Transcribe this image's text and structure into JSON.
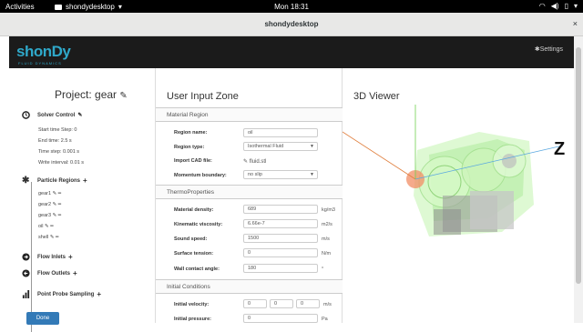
{
  "topbar": {
    "activities": "Activities",
    "app_name": "shondydesktop",
    "clock": "Mon 18:31"
  },
  "window": {
    "title": "shondydesktop",
    "close": "×"
  },
  "header": {
    "logo": "shonDy",
    "logo_sub": "FLUID DYNAMICS",
    "settings": "Settings"
  },
  "project": {
    "title": "Project: gear"
  },
  "solver": {
    "label": "Solver Control",
    "items": [
      "Start time Step: 0",
      "End time: 2.5 s",
      "Time step: 0.001 s",
      "Write interval: 0.01 s"
    ]
  },
  "particles": {
    "label": "Particle Regions",
    "items": [
      "gear1",
      "gear2",
      "gear3",
      "oil",
      "shell"
    ]
  },
  "flow_inlets": "Flow Inlets",
  "flow_outlets": "Flow Outlets",
  "probe": "Point Probe Sampling",
  "done": "Done",
  "input": {
    "title": "User Input Zone",
    "material_section": "Material Region",
    "region_name_label": "Region name:",
    "region_name": "oil",
    "region_type_label": "Region type:",
    "region_type": "Isothermal Fluid",
    "import_cad_label": "Import CAD file:",
    "cad_file": "fluid.stl",
    "momentum_label": "Momentum boundary:",
    "momentum": "no slip",
    "thermo_section": "ThermoProperties",
    "density_label": "Material density:",
    "density": "689",
    "density_unit": "kg/m3",
    "viscosity_label": "Kinematic viscosity:",
    "viscosity": "6.66e-7",
    "viscosity_unit": "m2/s",
    "sound_label": "Sound speed:",
    "sound": "1500",
    "sound_unit": "m/s",
    "tension_label": "Surface tension:",
    "tension": "0",
    "tension_unit": "N/m",
    "angle_label": "Wall contact angle:",
    "angle": "180",
    "angle_unit": "°",
    "initial_section": "Initial Conditions",
    "velocity_label": "Initial velocity:",
    "velocity": [
      "0",
      "0",
      "0"
    ],
    "velocity_unit": "m/s",
    "pressure_label": "Initial pressure:",
    "pressure": "0",
    "pressure_unit": "Pa"
  },
  "viewer": {
    "title": "3D Viewer",
    "axis_label": "Z"
  }
}
